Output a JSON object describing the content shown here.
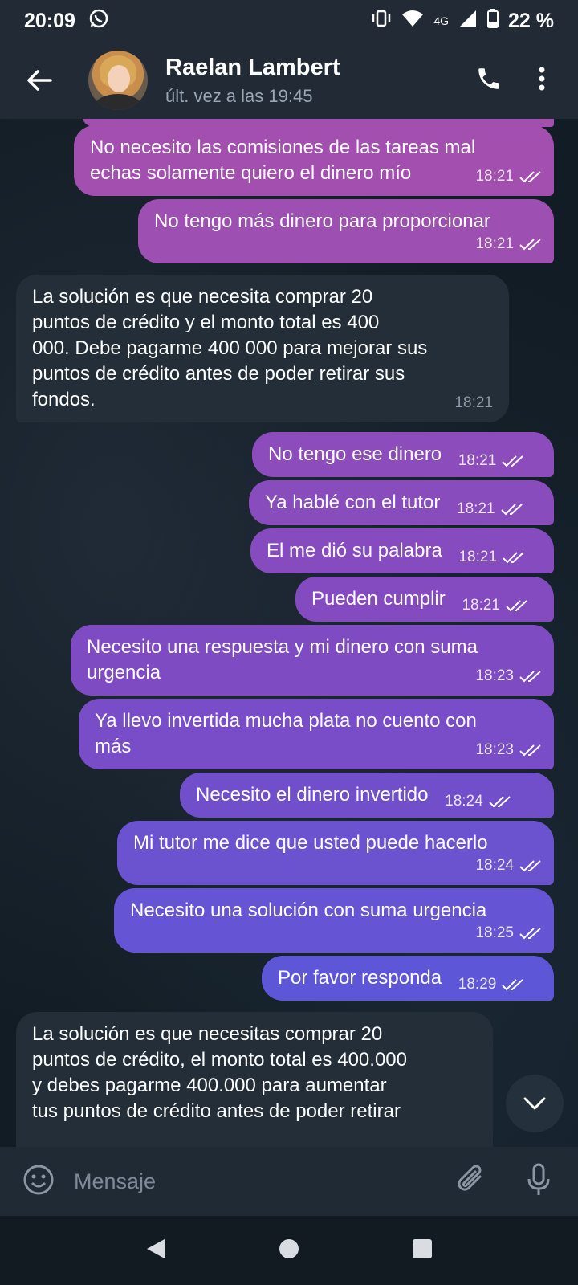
{
  "status_bar": {
    "time": "20:09",
    "network": "4G",
    "battery": "22 %"
  },
  "header": {
    "contact_name": "Raelan Lambert",
    "last_seen": "últ. vez a las 19:45"
  },
  "messages": [
    {
      "dir": "out",
      "lines": [
        "No necesito las comisiones de las tareas mal",
        "echas solamente quiero el dinero mío"
      ],
      "time": "18:21"
    },
    {
      "dir": "out",
      "lines": [
        "No tengo más dinero para proporcionar"
      ],
      "time": "18:21"
    },
    {
      "dir": "in",
      "lines": [
        "La solución es que necesita comprar 20",
        "puntos de crédito y el monto total es 400",
        "000. Debe pagarme 400 000 para mejorar sus",
        "puntos de crédito antes de poder retirar sus",
        "fondos."
      ],
      "time": "18:21"
    },
    {
      "dir": "out",
      "lines": [
        "No tengo ese dinero"
      ],
      "time": "18:21"
    },
    {
      "dir": "out",
      "lines": [
        "Ya hablé con el tutor"
      ],
      "time": "18:21"
    },
    {
      "dir": "out",
      "lines": [
        "El me dió su palabra"
      ],
      "time": "18:21"
    },
    {
      "dir": "out",
      "lines": [
        "Pueden cumplir"
      ],
      "time": "18:21"
    },
    {
      "dir": "out",
      "lines": [
        "Necesito una respuesta y mi dinero con suma",
        "urgencia"
      ],
      "time": "18:23"
    },
    {
      "dir": "out",
      "lines": [
        "Ya llevo invertida mucha plata no cuento con",
        "más"
      ],
      "time": "18:23"
    },
    {
      "dir": "out",
      "lines": [
        "Necesito el dinero invertido"
      ],
      "time": "18:24"
    },
    {
      "dir": "out",
      "lines": [
        "Mi tutor me dice que usted puede hacerlo"
      ],
      "time": "18:24"
    },
    {
      "dir": "out",
      "lines": [
        "Necesito una solución con suma urgencia"
      ],
      "time": "18:25"
    },
    {
      "dir": "out",
      "lines": [
        "Por favor responda"
      ],
      "time": "18:29"
    },
    {
      "dir": "in",
      "lines": [
        "La solución es que necesitas comprar 20",
        "puntos de crédito, el monto total es 400.000",
        "y debes pagarme 400.000 para aumentar",
        "tus puntos de crédito antes de poder retirar"
      ],
      "time": ""
    }
  ],
  "composer": {
    "placeholder": "Mensaje"
  },
  "icons": {
    "whatsapp": "whatsapp-icon",
    "vibrate": "vibrate-icon",
    "wifi": "wifi-icon",
    "signal": "signal-icon",
    "battery": "battery-icon",
    "back": "back-arrow-icon",
    "call": "phone-icon",
    "menu": "more-vert-icon",
    "emoji": "emoji-icon",
    "attach": "paperclip-icon",
    "mic": "microphone-icon",
    "scroll": "chevron-down-icon",
    "ticks": "double-check-icon"
  },
  "colors": {
    "outgoing_top": "#9c4fb7",
    "outgoing_mid": "#7a45c9",
    "outgoing_bottom": "#5b5bd9",
    "incoming": "#232e38",
    "header": "#222b35"
  }
}
